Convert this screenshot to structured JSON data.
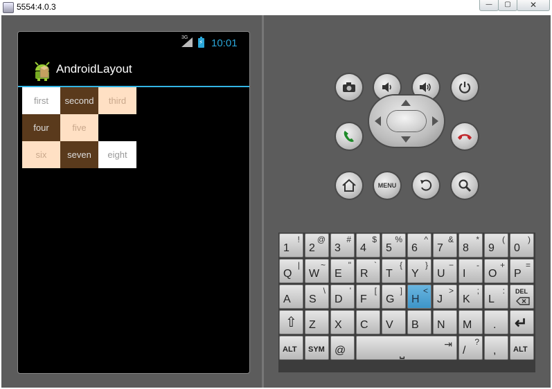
{
  "window": {
    "title": "5554:4.0.3",
    "buttons": {
      "minimize": "—",
      "maximize": "▢",
      "close": "✕"
    }
  },
  "statusbar": {
    "network": "3G",
    "battery_icon": "battery-charging-icon",
    "time": "10:01"
  },
  "actionbar": {
    "app_title": "AndroidLayout",
    "icon": "android-icon"
  },
  "colors": {
    "light": "#ffffff",
    "dark": "#5a3a1c",
    "peach": "#ffe0c4",
    "accent": "#33b5e5"
  },
  "grid": [
    [
      {
        "label": "first",
        "style": "white"
      },
      {
        "label": "second",
        "style": "dark"
      },
      {
        "label": "third",
        "style": "peach"
      }
    ],
    [
      {
        "label": "four",
        "style": "dark"
      },
      {
        "label": "five",
        "style": "peach"
      }
    ],
    [
      {
        "label": "six",
        "style": "peach"
      },
      {
        "label": "seven",
        "style": "dark"
      },
      {
        "label": "eight",
        "style": "white"
      }
    ]
  ],
  "controls": {
    "row1": [
      "camera-icon",
      "volume-down-icon",
      "volume-up-icon",
      "power-icon"
    ],
    "row2": [
      "call-icon",
      "dpad",
      "end-call-icon"
    ],
    "row3": [
      "home-icon",
      "menu-button",
      "back-icon",
      "search-icon"
    ],
    "menu_label": "MENU"
  },
  "keyboard": {
    "rows": [
      [
        [
          "1",
          "!"
        ],
        [
          "2",
          "@"
        ],
        [
          "3",
          "#"
        ],
        [
          "4",
          "$"
        ],
        [
          "5",
          "%"
        ],
        [
          "6",
          "^"
        ],
        [
          "7",
          "&"
        ],
        [
          "8",
          "*"
        ],
        [
          "9",
          "("
        ],
        [
          "0",
          ")"
        ]
      ],
      [
        [
          "Q",
          "|"
        ],
        [
          "W",
          "~"
        ],
        [
          "E",
          "\""
        ],
        [
          "R",
          "`"
        ],
        [
          "T",
          "{"
        ],
        [
          "Y",
          "}"
        ],
        [
          "U",
          "−"
        ],
        [
          "I",
          "-"
        ],
        [
          "O",
          "+"
        ],
        [
          "P",
          "="
        ]
      ],
      [
        [
          "A",
          ""
        ],
        [
          "S",
          "\\"
        ],
        [
          "D",
          "'"
        ],
        [
          "F",
          "["
        ],
        [
          "G",
          "]"
        ],
        [
          "H",
          "<"
        ],
        [
          "J",
          ">"
        ],
        [
          "K",
          ";"
        ],
        [
          "L",
          ":"
        ],
        [
          "DEL",
          ""
        ]
      ],
      [
        [
          "⇧",
          ""
        ],
        [
          "Z",
          ""
        ],
        [
          "X",
          ""
        ],
        [
          "C",
          ""
        ],
        [
          "V",
          ""
        ],
        [
          "B",
          ""
        ],
        [
          "N",
          ""
        ],
        [
          "M",
          ""
        ],
        [
          ".",
          ""
        ],
        [
          "↵",
          ""
        ]
      ]
    ],
    "bottom": {
      "alt_left": "ALT",
      "sym": "SYM",
      "at": "@",
      "space_tab": "⇥",
      "space": "⎵",
      "slash": "/",
      "question": "?",
      "comma": ",",
      "alt_right": "ALT"
    },
    "highlighted": "H"
  }
}
